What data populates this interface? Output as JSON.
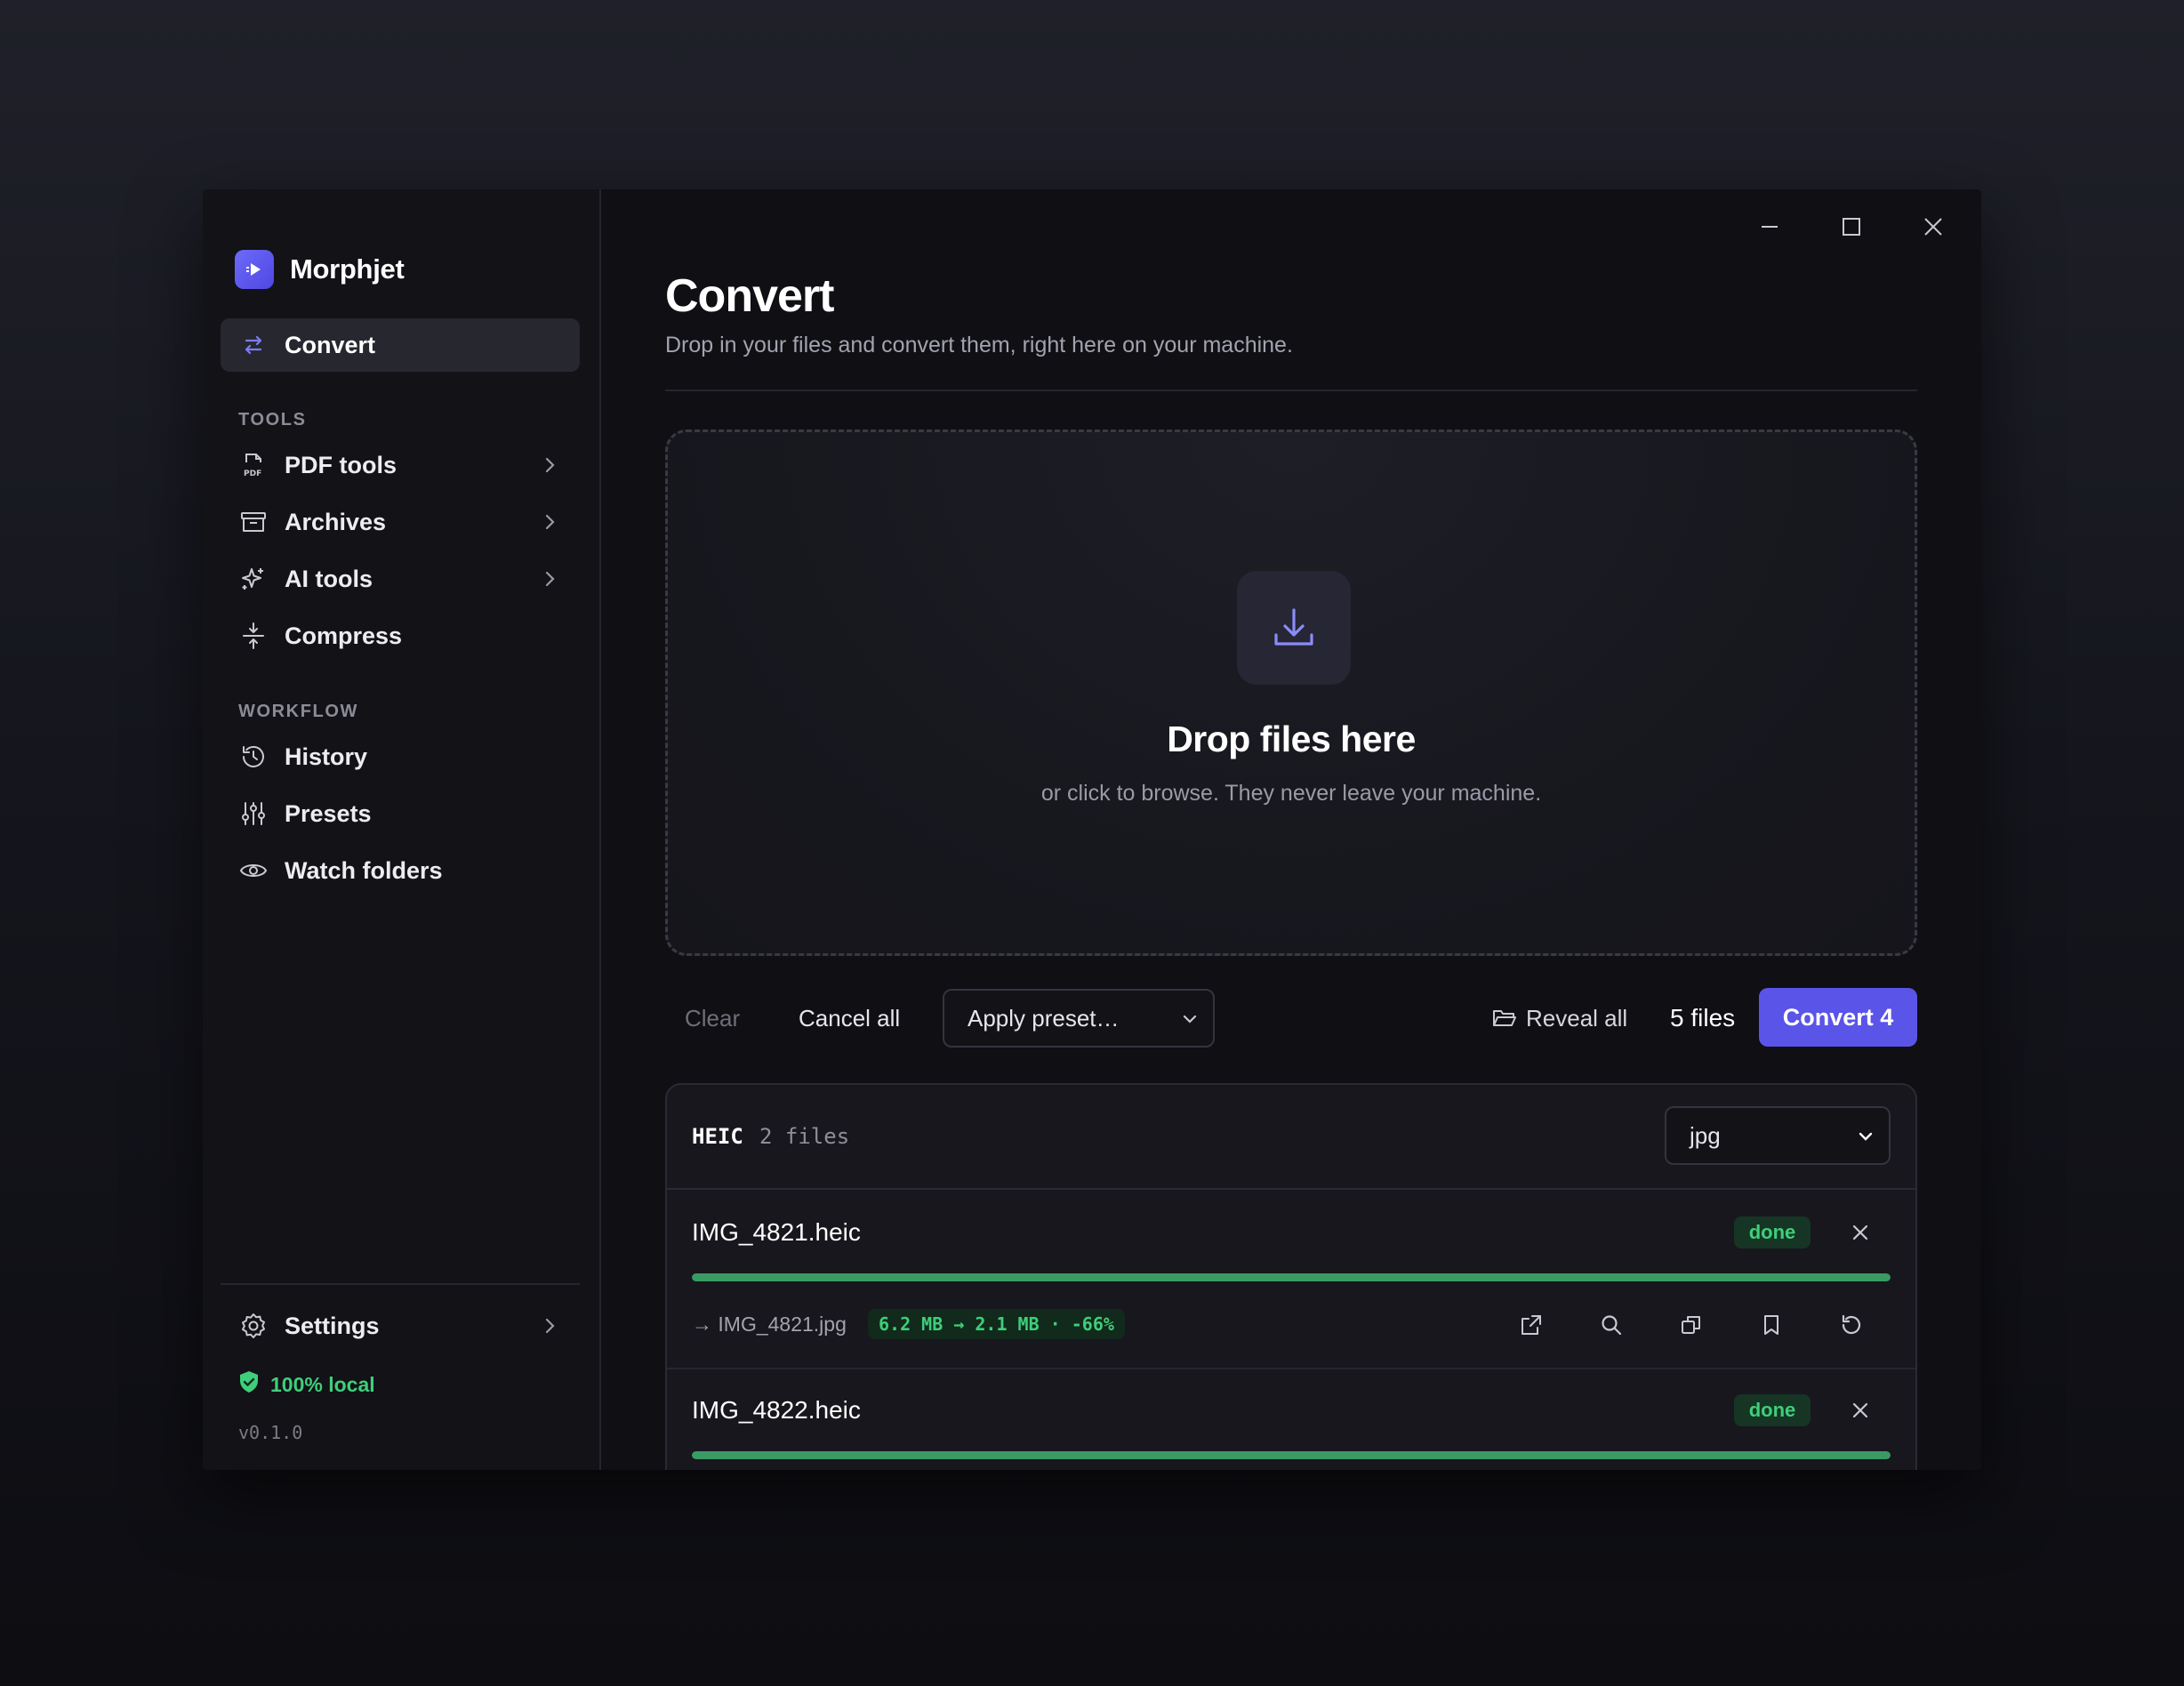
{
  "app": {
    "name": "Morphjet",
    "accent": "#5b54e8",
    "success": "#3ecf7a"
  },
  "sidebar": {
    "primary": {
      "label": "Convert",
      "icon": "arrows-swap-icon"
    },
    "tools_label": "TOOLS",
    "tools": [
      {
        "label": "PDF tools",
        "icon": "pdf-icon",
        "has_submenu": true
      },
      {
        "label": "Archives",
        "icon": "archive-icon",
        "has_submenu": true
      },
      {
        "label": "AI tools",
        "icon": "sparkle-icon",
        "has_submenu": true
      },
      {
        "label": "Compress",
        "icon": "compress-icon",
        "has_submenu": false
      }
    ],
    "workflow_label": "WORKFLOW",
    "workflow": [
      {
        "label": "History",
        "icon": "history-icon"
      },
      {
        "label": "Presets",
        "icon": "sliders-icon"
      },
      {
        "label": "Watch folders",
        "icon": "eye-icon"
      }
    ],
    "settings": {
      "label": "Settings",
      "icon": "gear-icon"
    },
    "local_badge": "100% local",
    "version": "v0.1.0"
  },
  "main": {
    "title": "Convert",
    "subtitle": "Drop in your files and convert them, right here on your machine.",
    "dropzone": {
      "title": "Drop files here",
      "subtitle": "or click to browse. They never leave your machine."
    },
    "toolbar": {
      "clear": "Clear",
      "cancel_all": "Cancel all",
      "preset_placeholder": "Apply preset…",
      "reveal_all": "Reveal all",
      "file_count": "5 files",
      "convert": "Convert 4"
    },
    "group": {
      "type": "HEIC",
      "count": "2 files",
      "target_format": "jpg",
      "files": [
        {
          "name": "IMG_4821.heic",
          "status": "done",
          "progress": 1.0,
          "output": "→ IMG_4821.jpg",
          "size_delta": "6.2 MB → 2.1 MB · -66%"
        },
        {
          "name": "IMG_4822.heic",
          "status": "done",
          "progress": 1.0
        }
      ]
    }
  }
}
